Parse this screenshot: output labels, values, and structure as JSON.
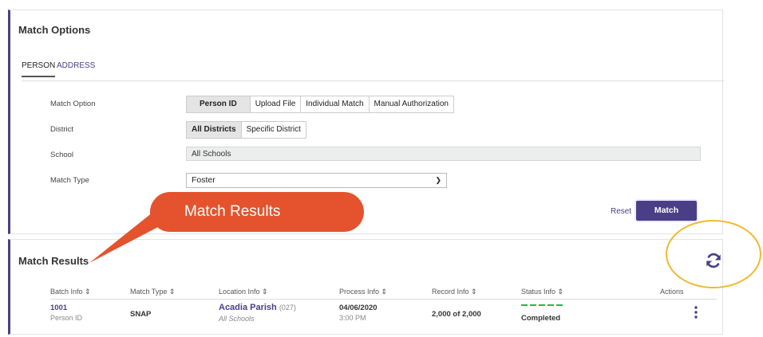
{
  "match_options": {
    "title": "Match Options",
    "tabs": [
      {
        "label": "PERSON",
        "active": true
      },
      {
        "label": "ADDRESS",
        "active": false
      }
    ],
    "match_option": {
      "label": "Match Option",
      "options": [
        "Person ID",
        "Upload File",
        "Individual Match",
        "Manual Authorization"
      ],
      "selected": "Person ID"
    },
    "district": {
      "label": "District",
      "options": [
        "All Districts",
        "Specific District"
      ],
      "selected": "All Districts"
    },
    "school": {
      "label": "School",
      "value": "All Schools"
    },
    "match_type": {
      "label": "Match Type",
      "value": "Foster"
    },
    "reset_label": "Reset",
    "match_label": "Match"
  },
  "callout": {
    "text": "Match Results"
  },
  "match_results": {
    "title": "Match Results",
    "columns": [
      "Batch Info ⇕",
      "Match Type ⇕",
      "Location Info ⇕",
      "Process Info ⇕",
      "Record Info ⇕",
      "Status Info ⇕",
      "Actions"
    ],
    "rows": [
      {
        "batch_id": "1001",
        "batch_type": "Person ID",
        "match_type": "SNAP",
        "location": "Acadia Parish",
        "location_code": "(027)",
        "location_sub": "All Schools",
        "process_date": "04/06/2020",
        "process_time": "3:00 PM",
        "records": "2,000 of 2,000",
        "status": "Completed"
      }
    ]
  },
  "icons": {
    "refresh": "refresh-icon",
    "actions": "kebab-menu-icon"
  },
  "colors": {
    "accent": "#4a3f87",
    "callout": "#e4532d",
    "highlight": "#f2b82e",
    "status_bar": "#2bb24c"
  }
}
